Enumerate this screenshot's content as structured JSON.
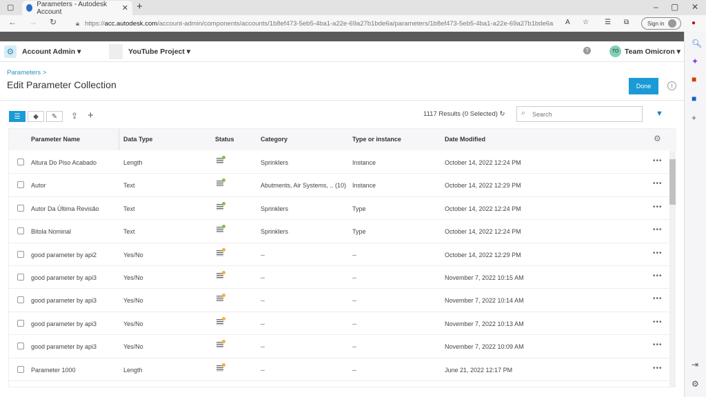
{
  "browser": {
    "tab_title": "Parameters - Autodesk Account",
    "url_prefix": "https://",
    "url_domain": "acc.autodesk.com",
    "url_path": "/account-admin/components/accounts/1b8ef473-5eb5-4ba1-a22e-69a27b1bde6a/parameters/1b8ef473-5eb5-4ba1-a22e-69a27b1bde6a",
    "signin": "Sign in"
  },
  "header": {
    "app": "Account Admin",
    "project": "YouTube Project",
    "user_initials": "TO",
    "user": "Team Omicron"
  },
  "page": {
    "breadcrumb": "Parameters >",
    "title": "Edit Parameter Collection",
    "done": "Done"
  },
  "toolbar": {
    "results": "1117 Results (0 Selected)",
    "search_placeholder": "Search"
  },
  "table": {
    "columns": [
      "Parameter Name",
      "Data Type",
      "Status",
      "Category",
      "Type or instance",
      "Date Modified"
    ],
    "status_colors": {
      "ok": "#7cc243",
      "pending": "#f2b134"
    },
    "rows": [
      {
        "name": "Altura Do Piso Acabado",
        "type": "Length",
        "status": "ok",
        "category": "Sprinklers",
        "ti": "Instance",
        "date": "October 14, 2022 12:24 PM"
      },
      {
        "name": "Autor",
        "type": "Text",
        "status": "ok",
        "category": "Abutments, Air Systems, .. (10)",
        "ti": "Instance",
        "date": "October 14, 2022 12:29 PM"
      },
      {
        "name": "Autor Da Última Revisão",
        "type": "Text",
        "status": "ok",
        "category": "Sprinklers",
        "ti": "Type",
        "date": "October 14, 2022 12:24 PM"
      },
      {
        "name": "Bitola Nominal",
        "type": "Text",
        "status": "ok",
        "category": "Sprinklers",
        "ti": "Type",
        "date": "October 14, 2022 12:24 PM"
      },
      {
        "name": "good parameter by api2",
        "type": "Yes/No",
        "status": "pending",
        "category": "--",
        "ti": "--",
        "date": "October 14, 2022 12:29 PM"
      },
      {
        "name": "good parameter by api3",
        "type": "Yes/No",
        "status": "pending",
        "category": "--",
        "ti": "--",
        "date": "November 7, 2022 10:15 AM"
      },
      {
        "name": "good parameter by api3",
        "type": "Yes/No",
        "status": "pending",
        "category": "--",
        "ti": "--",
        "date": "November 7, 2022 10:14 AM"
      },
      {
        "name": "good parameter by api3",
        "type": "Yes/No",
        "status": "pending",
        "category": "--",
        "ti": "--",
        "date": "November 7, 2022 10:13 AM"
      },
      {
        "name": "good parameter by api3",
        "type": "Yes/No",
        "status": "pending",
        "category": "--",
        "ti": "--",
        "date": "November 7, 2022 10:09 AM"
      },
      {
        "name": "Parameter 1000",
        "type": "Length",
        "status": "pending",
        "category": "--",
        "ti": "--",
        "date": "June 21, 2022 12:17 PM"
      }
    ]
  }
}
